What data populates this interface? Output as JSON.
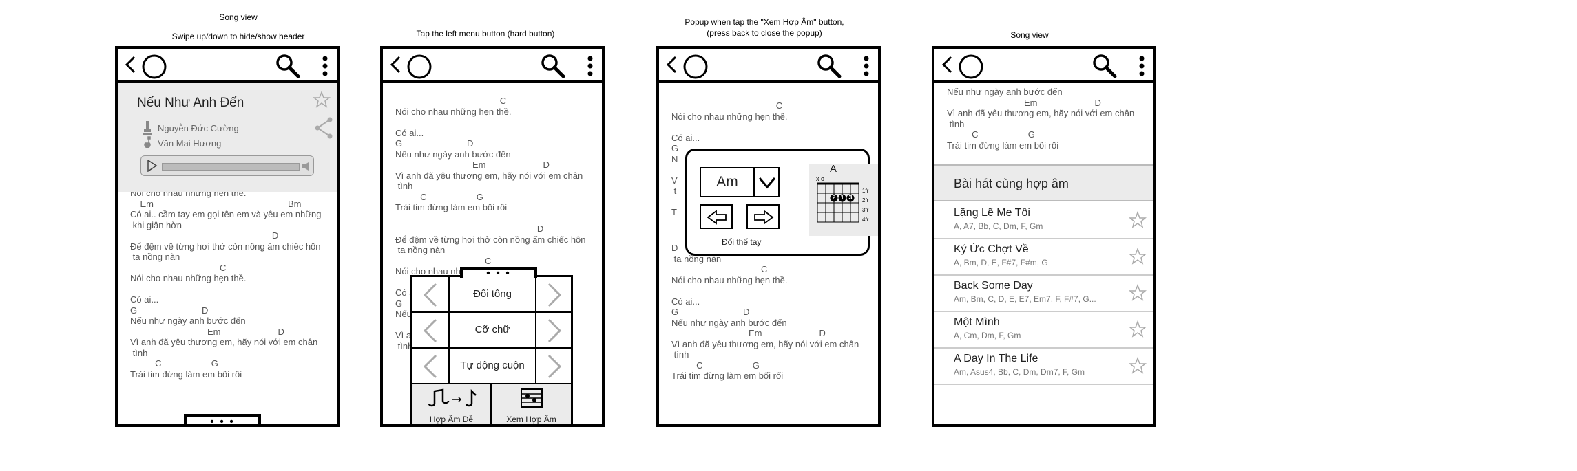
{
  "captions": {
    "p1_line1": "Song view",
    "p1_line2": "Swipe up/down to hide/show header",
    "p2": "Tap the left menu button (hard button)",
    "p3_line1": "Popup when tap the \"Xem Hợp Âm\" button,",
    "p3_line2": "(press back to close the popup)",
    "p4": "Song view"
  },
  "song": {
    "title": "Nếu Như Anh Đến",
    "composer": "Nguyễn Đức Cường",
    "singer": "Văn Mai Hương"
  },
  "handle_dots": "• • •",
  "lyrics_p1": [
    "Nói cho nhau những hẹn thề.",
    "    Em                                                      Bm",
    "Có ai.. cầm tay em gọi tên em và yêu em những",
    " khi giận hờn",
    "                                                         D",
    "Để đệm về từng hơi thở còn nồng ấm chiếc hôn",
    " ta nồng nàn",
    "                                    C",
    "Nói cho nhau những hẹn thề.",
    "",
    "Có ai...",
    "G                          D",
    "Nếu như ngày anh bước đến",
    "                               Em                       D",
    "Vì anh đã yêu thương em, hãy nói với em chân",
    " tình",
    "          C                    G",
    "Trái tim đừng làm em bối rối"
  ],
  "lyrics_p2": [
    "                                          C",
    "Nói cho nhau những hẹn thề.",
    "",
    "Có ai...",
    "G                          D",
    "Nếu như ngày anh bước đến",
    "                               Em                       D",
    "Vì anh đã yêu thương em, hãy nói với em chân",
    " tình",
    "          C                    G",
    "Trái tim đừng làm em bối rối",
    "",
    "                                                         D",
    "Để đệm về từng hơi thở còn nồng ấm chiếc hôn",
    " ta nồng nàn",
    "                                    C",
    "Nói cho nhau những hẹn thề.",
    "",
    "Có ai...",
    "G",
    "Nếu",
    "",
    "Vì a",
    " tình"
  ],
  "lyrics_p3_top": [
    "                                          C",
    "Nói cho nhau những hẹn thề.",
    "",
    "Có ai...",
    "G",
    "N",
    "",
    "V",
    " t",
    "",
    "T"
  ],
  "lyrics_p3_bottom": [
    "Đ",
    " ta nồng nàn",
    "                                    C",
    "Nói cho nhau những hẹn thề.",
    "",
    "Có ai...",
    "G                          D",
    "Nếu như ngày anh bước đến",
    "                               Em                       D",
    "Vì anh đã yêu thương em, hãy nói với em chân",
    " tình",
    "          C                    G",
    "Trái tim đừng làm em bối rối"
  ],
  "lyrics_p4": [
    "Nếu như ngày anh bước đến",
    "                               Em                       D",
    "Vì anh đã yêu thương em, hãy nói với em chân",
    " tình",
    "          C                    G",
    "Trái tim đừng làm em bối rối"
  ],
  "menu": {
    "items": [
      {
        "label": "Đổi tông"
      },
      {
        "label": "Cỡ chữ"
      },
      {
        "label": "Tự động cuộn"
      }
    ],
    "bottom_left": "Hợp Âm Dễ",
    "bottom_right": "Xem Hợp Âm"
  },
  "popup": {
    "chord": "Am",
    "label": "Đổi thế tay",
    "diagram_title": "A",
    "open_marks": "x o",
    "fingers": [
      "2",
      "1",
      "3"
    ],
    "frets": [
      "1fr",
      "2fr",
      "3fr",
      "4fr"
    ]
  },
  "related": {
    "heading": "Bài hát cùng hợp âm",
    "songs": [
      {
        "title": "Lặng Lẽ Me Tôi",
        "chords": "A, A7, Bb, C, Dm, F, Gm"
      },
      {
        "title": "Ký Ức Chợt Về",
        "chords": "A, Bm, D, E, F#7, F#m, G"
      },
      {
        "title": "Back Some Day",
        "chords": "Am, Bm, C, D, E, E7, Em7, F, F#7, G..."
      },
      {
        "title": "Một Mình",
        "chords": "A, Cm, Dm, F, Gm"
      },
      {
        "title": "A Day In The Life",
        "chords": "Am, Asus4, Bb, C, Dm, Dm7, F, Gm"
      }
    ]
  }
}
